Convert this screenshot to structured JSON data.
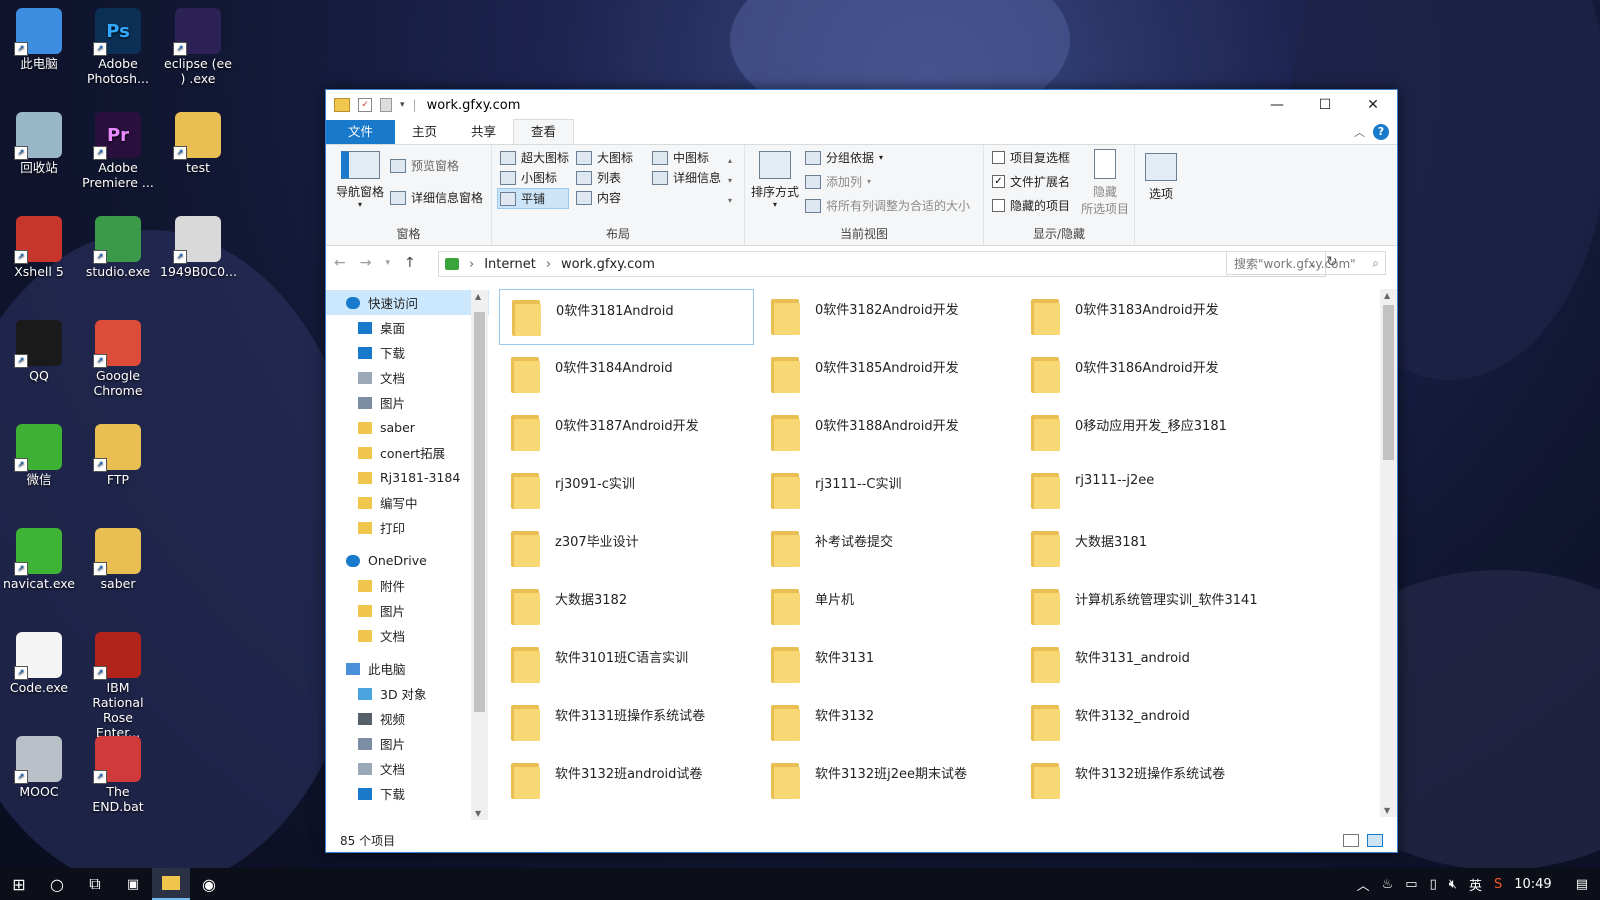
{
  "desktop": {
    "icons": [
      {
        "label": "此电脑",
        "icon": "this-pc-icon",
        "color": "#3d8ee0"
      },
      {
        "label": "Adobe Photosh...",
        "icon": "photoshop-icon",
        "color": "#0b2f55",
        "glyph": "Ps"
      },
      {
        "label": "eclipse (ee ) .exe",
        "icon": "eclipse-icon",
        "color": "#2c2255"
      },
      {
        "label": "回收站",
        "icon": "recycle-bin-icon",
        "color": "#9ab7c9"
      },
      {
        "label": "Adobe Premiere ...",
        "icon": "premiere-icon",
        "color": "#2a0f3f",
        "glyph": "Pr"
      },
      {
        "label": "test",
        "icon": "folder-icon",
        "color": "#e9bf54"
      },
      {
        "label": "Xshell 5",
        "icon": "xshell-icon",
        "color": "#c8362b"
      },
      {
        "label": "studio.exe",
        "icon": "android-studio-icon",
        "color": "#3a9a4a"
      },
      {
        "label": "1949B0C0...",
        "icon": "file-thumbnail-icon",
        "color": "#d9d9d9"
      },
      {
        "label": "QQ",
        "icon": "qq-icon",
        "color": "#1a1a1a"
      },
      {
        "label": "Google Chrome",
        "icon": "chrome-icon",
        "color": "#dd4b39"
      },
      {
        "label": "微信",
        "icon": "wechat-icon",
        "color": "#3eb034"
      },
      {
        "label": "FTP",
        "icon": "folder-icon",
        "color": "#e9bf54"
      },
      {
        "label": "navicat.exe",
        "icon": "navicat-icon",
        "color": "#3fb335"
      },
      {
        "label": "saber",
        "icon": "folder-icon",
        "color": "#e9bf54"
      },
      {
        "label": "Code.exe",
        "icon": "file-icon",
        "color": "#f4f4f4"
      },
      {
        "label": "IBM Rational Rose Enter...",
        "icon": "rational-rose-icon",
        "color": "#b2231c"
      },
      {
        "label": "MOOC",
        "icon": "mooc-icon",
        "color": "#b9c0c8"
      },
      {
        "label": "The END.bat",
        "icon": "bat-file-icon",
        "color": "#d03a3a"
      }
    ]
  },
  "window": {
    "title": "work.gfxy.com",
    "tabs": [
      "文件",
      "主页",
      "共享",
      "查看"
    ],
    "active_tab": "查看",
    "ribbon": {
      "panes": {
        "nav_pane": "导航窗格",
        "preview_pane": "预览窗格",
        "details_pane": "详细信息窗格",
        "label": "窗格"
      },
      "layout": {
        "options": [
          "超大图标",
          "大图标",
          "中图标",
          "小图标",
          "列表",
          "详细信息",
          "平铺",
          "内容"
        ],
        "selected": "平铺",
        "label": "布局"
      },
      "current_view": {
        "sort": "排序方式",
        "group_by": "分组依据",
        "add_column": "添加列",
        "fit_columns": "将所有列调整为合适的大小",
        "label": "当前视图"
      },
      "show_hide": {
        "item_checkboxes": "项目复选框",
        "file_extensions": "文件扩展名",
        "hidden_items": "隐藏的项目",
        "hide_selected_line1": "隐藏",
        "hide_selected_line2": "所选项目",
        "label": "显示/隐藏"
      },
      "options": "选项"
    },
    "address": {
      "crumbs": [
        "Internet",
        "work.gfxy.com"
      ],
      "search_placeholder": "搜索\"work.gfxy.com\""
    },
    "nav": [
      {
        "label": "快速访问",
        "icon": "star-icon",
        "indent": 0,
        "pinned": false,
        "selected": true
      },
      {
        "label": "桌面",
        "icon": "desktop-icon",
        "indent": 1,
        "pinned": true
      },
      {
        "label": "下载",
        "icon": "download-icon",
        "indent": 1,
        "pinned": true
      },
      {
        "label": "文档",
        "icon": "documents-icon",
        "indent": 1,
        "pinned": true
      },
      {
        "label": "图片",
        "icon": "pictures-icon",
        "indent": 1,
        "pinned": true
      },
      {
        "label": "saber",
        "icon": "folder-icon",
        "indent": 1,
        "pinned": true
      },
      {
        "label": "conert拓展",
        "icon": "folder-icon",
        "indent": 1,
        "pinned": false
      },
      {
        "label": "Rj3181-3184",
        "icon": "folder-icon",
        "indent": 1,
        "pinned": false
      },
      {
        "label": "编写中",
        "icon": "folder-icon",
        "indent": 1,
        "pinned": false
      },
      {
        "label": "打印",
        "icon": "folder-icon",
        "indent": 1,
        "pinned": false
      },
      {
        "label": "",
        "icon": "",
        "indent": 0,
        "spacer": true
      },
      {
        "label": "OneDrive",
        "icon": "cloud-icon",
        "indent": 0,
        "pinned": false
      },
      {
        "label": "附件",
        "icon": "folder-icon",
        "indent": 1,
        "pinned": false
      },
      {
        "label": "图片",
        "icon": "folder-icon",
        "indent": 1,
        "pinned": false
      },
      {
        "label": "文档",
        "icon": "folder-icon",
        "indent": 1,
        "pinned": false
      },
      {
        "label": "",
        "icon": "",
        "indent": 0,
        "spacer": true
      },
      {
        "label": "此电脑",
        "icon": "computer-icon",
        "indent": 0,
        "pinned": false
      },
      {
        "label": "3D 对象",
        "icon": "cube-icon",
        "indent": 1,
        "pinned": false
      },
      {
        "label": "视频",
        "icon": "video-icon",
        "indent": 1,
        "pinned": false
      },
      {
        "label": "图片",
        "icon": "pictures-icon",
        "indent": 1,
        "pinned": false
      },
      {
        "label": "文档",
        "icon": "documents-icon",
        "indent": 1,
        "pinned": false
      },
      {
        "label": "下载",
        "icon": "download-icon",
        "indent": 1,
        "pinned": false
      }
    ],
    "items": [
      "0软件3181Android",
      "0软件3182Android开发",
      "0软件3183Android开发",
      "0软件3184Android",
      "0软件3185Android开发",
      "0软件3186Android开发",
      "0软件3187Android开发",
      "0软件3188Android开发",
      "0移动应用开发_移应3181",
      "rj3091-c实训",
      "rj3111--C实训",
      "rj3111--j2ee",
      "z307毕业设计",
      "补考试卷提交",
      "大数据3181",
      "大数据3182",
      "单片机",
      "计算机系统管理实训_软件3141",
      "软件3101班C语言实训",
      "软件3131",
      "软件3131_android",
      "软件3131班操作系统试卷",
      "软件3132",
      "软件3132_android",
      "软件3132班android试卷",
      "软件3132班j2ee期末试卷",
      "软件3132班操作系统试卷"
    ],
    "selected_item_index": 0,
    "status": "85 个项目"
  },
  "taskbar": {
    "time": "10:49",
    "ime": "英"
  }
}
